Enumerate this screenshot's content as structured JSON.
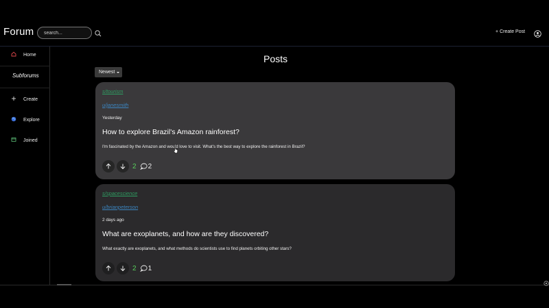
{
  "app": {
    "brand": "Forum"
  },
  "header": {
    "search_placeholder": "search...",
    "create_post_label": "Create Post"
  },
  "sidebar": {
    "home_label": "Home",
    "subforums_heading": "Subforums",
    "items": [
      {
        "label": "Create",
        "icon": "plus-icon"
      },
      {
        "label": "Explore",
        "icon": "globe-icon"
      },
      {
        "label": "Joined",
        "icon": "joined-icon"
      }
    ]
  },
  "main": {
    "title": "Posts",
    "sort": {
      "selected": "Newest"
    },
    "posts": [
      {
        "subforum": "s/tourism",
        "author": "u/janesmith",
        "date": "Yesterday",
        "title": "How to explore Brazil's Amazon rainforest?",
        "body": "I'm fascinated by the Amazon and would love to visit. What's the best way to explore the rainforest in Brazil?",
        "score": "2",
        "comments": "2"
      },
      {
        "subforum": "s/spacescience",
        "author": "u/brianpeterson",
        "date": "2 days ago",
        "title": "What are exoplanets, and how are they discovered?",
        "body": "What exactly are exoplanets, and what methods do scientists use to find planets orbiting other stars?",
        "score": "2",
        "comments": "1"
      }
    ]
  },
  "colors": {
    "subforum_link": "#2e9e62",
    "author_link": "#3b86c2",
    "score": "#58d05c",
    "card_1_bg": "#3a393b",
    "card_2_bg": "#2b2a2c",
    "home_icon": "#e0474c"
  }
}
